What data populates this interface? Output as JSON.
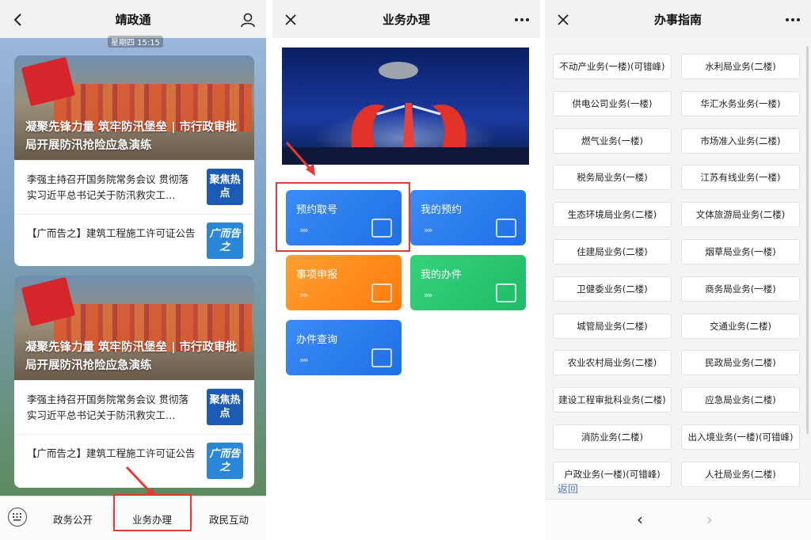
{
  "panel1": {
    "title": "靖政通",
    "timestamp": "星期四 15:15",
    "news_cards": [
      {
        "hero_caption": "凝聚先锋力量 筑牢防汛堡垒 | 市行政审批局开展防汛抢险应急演练",
        "items": [
          {
            "text": "李强主持召开国务院常务会议 贯彻落实习近平总书记关于防汛救灾工…",
            "thumb": "聚焦热点"
          },
          {
            "text": "【广而告之】建筑工程施工许可证公告",
            "thumb": "广而告之"
          }
        ]
      },
      {
        "hero_caption": "凝聚先锋力量 筑牢防汛堡垒 | 市行政审批局开展防汛抢险应急演练",
        "items": [
          {
            "text": "李强主持召开国务院常务会议 贯彻落实习近平总书记关于防汛救灾工…",
            "thumb": "聚焦热点"
          },
          {
            "text": "【广而告之】建筑工程施工许可证公告",
            "thumb": "广而告之"
          }
        ]
      }
    ],
    "bottom_nav": [
      "政务公开",
      "业务办理",
      "政民互动"
    ]
  },
  "panel2": {
    "title": "业务办理",
    "tiles": [
      "预约取号",
      "我的预约",
      "事项申报",
      "我的办件",
      "办件查询"
    ],
    "chevron": "»"
  },
  "panel3": {
    "title": "办事指南",
    "guides": [
      "不动产业务(一楼)(可错峰)",
      "水利局业务(二楼)",
      "供电公司业务(一楼)",
      "华汇水务业务(一楼)",
      "燃气业务(一楼)",
      "市场准入业务(二楼)",
      "税务局业务(一楼)",
      "江苏有线业务(一楼)",
      "生态环境局业务(二楼)",
      "文体旅游局业务(二楼)",
      "住建局业务(二楼)",
      "烟草局业务(一楼)",
      "卫健委业务(二楼)",
      "商务局业务(一楼)",
      "城管局业务(二楼)",
      "交通业务(二楼)",
      "农业农村局业务(二楼)",
      "民政局业务(二楼)",
      "建设工程审批科业务(二楼)",
      "应急局业务(二楼)",
      "消防业务(二楼)",
      "出入境业务(一楼)(可错峰)",
      "户政业务(一楼)(可错峰)",
      "人社局业务(二楼)"
    ],
    "back_label": "返回",
    "nav_back": "‹",
    "nav_forward": "›"
  },
  "colors": {
    "highlight": "#e53935",
    "tile_blue": "#2a7cf0",
    "tile_orange": "#ff8c1a",
    "tile_green": "#26c872"
  },
  "icons": [
    "chevron-left-icon",
    "user-icon",
    "close-icon",
    "more-icon",
    "keyboard-icon"
  ]
}
